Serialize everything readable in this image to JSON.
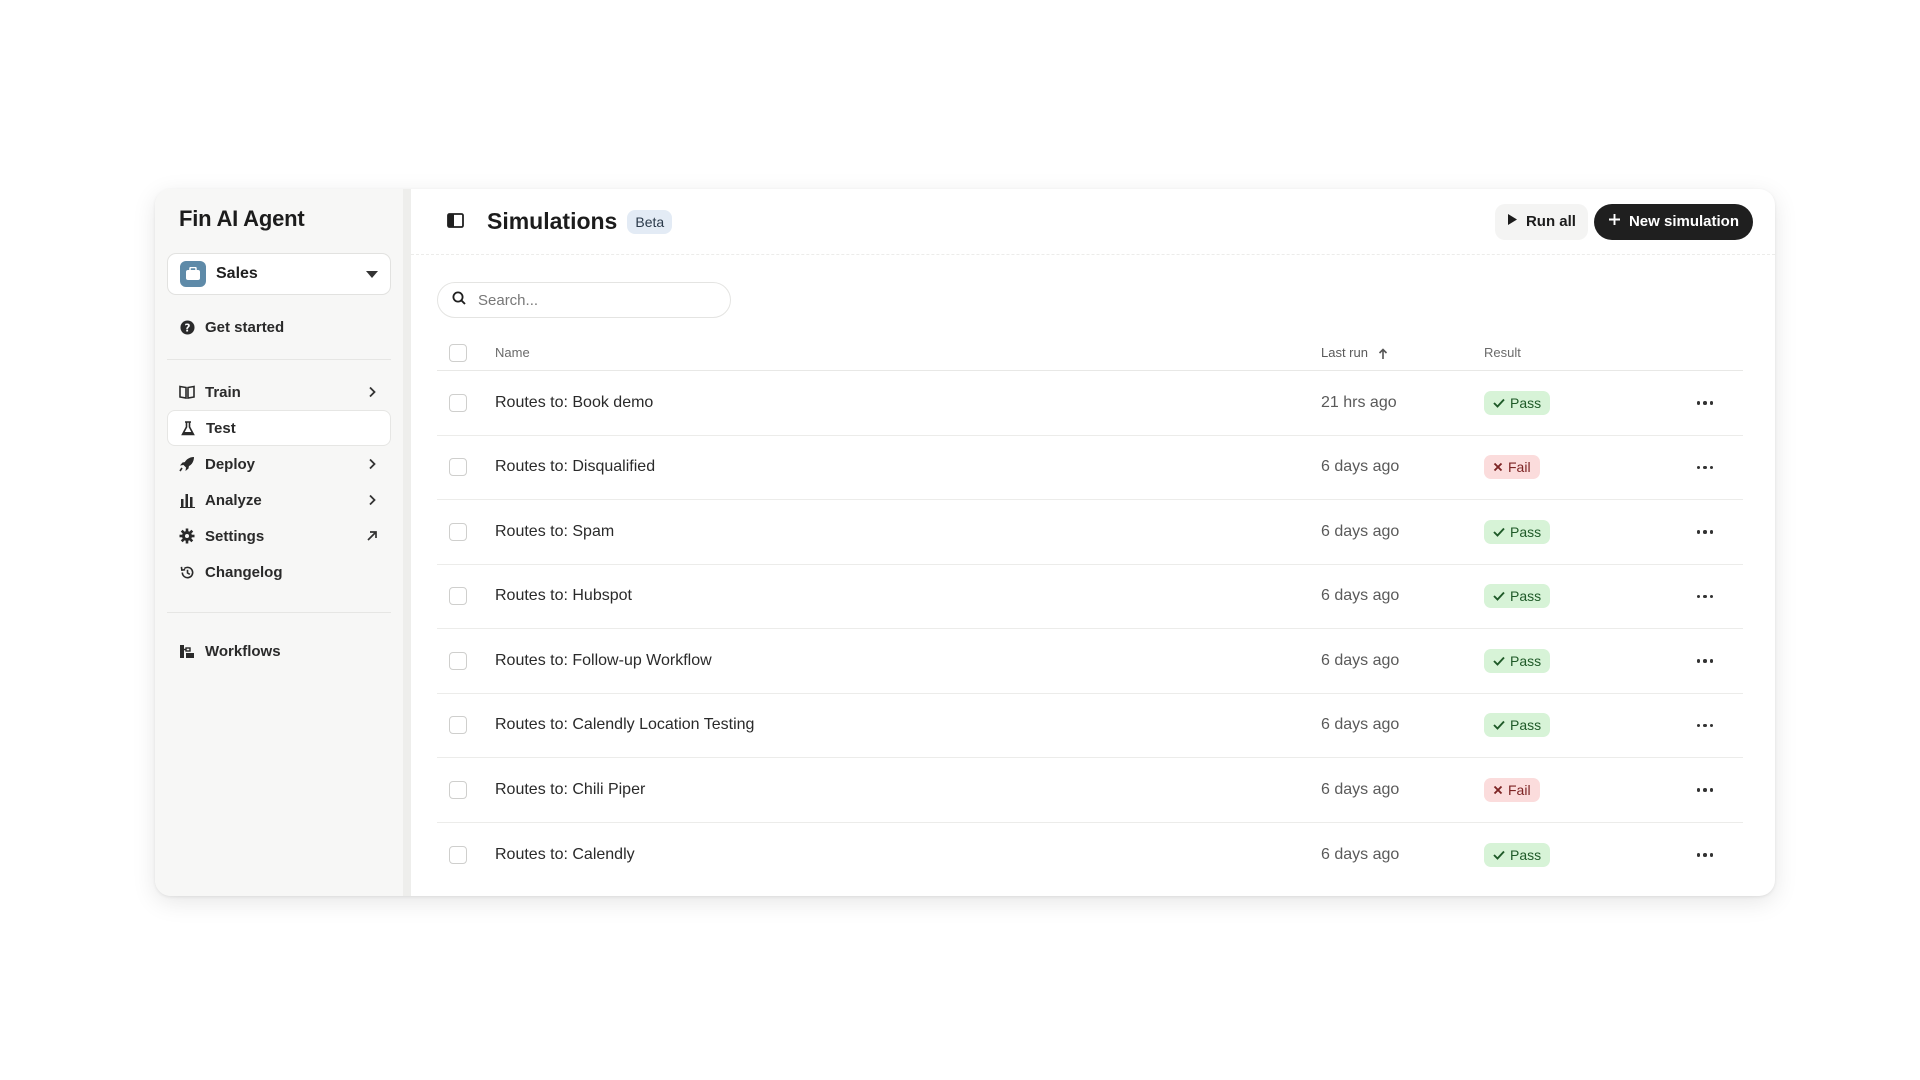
{
  "sidebar": {
    "app_title": "Fin AI Agent",
    "workspace": {
      "label": "Sales",
      "icon": "briefcase-icon",
      "icon_color": "#5e8aa8"
    },
    "items": [
      {
        "label": "Get started",
        "icon": "question-circle-icon"
      },
      {
        "label": "Train",
        "icon": "book-icon",
        "trail": "chevron-right-icon"
      },
      {
        "label": "Test",
        "icon": "flask-icon",
        "active": true
      },
      {
        "label": "Deploy",
        "icon": "rocket-icon",
        "trail": "chevron-right-icon"
      },
      {
        "label": "Analyze",
        "icon": "bar-chart-icon",
        "trail": "chevron-right-icon"
      },
      {
        "label": "Settings",
        "icon": "gear-icon",
        "trail": "external-arrow-icon"
      },
      {
        "label": "Changelog",
        "icon": "history-icon"
      },
      {
        "label": "Workflows",
        "icon": "workflow-icon"
      }
    ]
  },
  "header": {
    "title": "Simulations",
    "badge": "Beta",
    "run_all_label": "Run all",
    "new_simulation_label": "New simulation"
  },
  "search": {
    "placeholder": "Search...",
    "value": ""
  },
  "table": {
    "columns": {
      "name": "Name",
      "last_run": "Last run",
      "result": "Result"
    },
    "rows": [
      {
        "name": "Routes to: Book demo",
        "last_run": "21 hrs ago",
        "result": "Pass"
      },
      {
        "name": "Routes to: Disqualified",
        "last_run": "6 days ago",
        "result": "Fail"
      },
      {
        "name": "Routes to: Spam",
        "last_run": "6 days ago",
        "result": "Pass"
      },
      {
        "name": "Routes to: Hubspot",
        "last_run": "6 days ago",
        "result": "Pass"
      },
      {
        "name": "Routes to: Follow-up Workflow",
        "last_run": "6 days ago",
        "result": "Pass"
      },
      {
        "name": "Routes to: Calendly Location Testing",
        "last_run": "6 days ago",
        "result": "Pass"
      },
      {
        "name": "Routes to: Chili Piper",
        "last_run": "6 days ago",
        "result": "Fail"
      },
      {
        "name": "Routes to: Calendly",
        "last_run": "6 days ago",
        "result": "Pass"
      }
    ]
  },
  "colors": {
    "pass_bg": "#d7f3d7",
    "fail_bg": "#fbdcdc",
    "primary_button": "#1f1f1f",
    "beta_badge": "#e3ebf5"
  }
}
